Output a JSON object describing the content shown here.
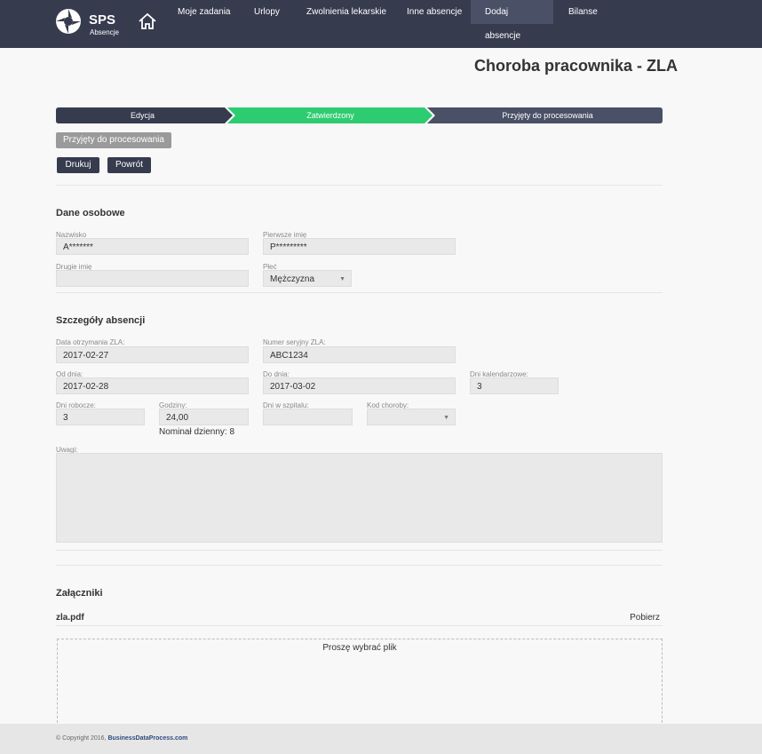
{
  "nav": {
    "brand": "SPS",
    "brand_sub": "Absencje",
    "items": [
      "Moje zadania",
      "Urlopy",
      "Zwolnienia lekarskie",
      "Inne absencje",
      "Dodaj absencje",
      "Bilanse"
    ],
    "active": "Dodaj absencje"
  },
  "page_title": "Choroba pracownika - ZLA",
  "steps": [
    "Edycja",
    "Zatwierdzony",
    "Przyjęty do procesowania"
  ],
  "status_button": "Przyjęty do procesowania",
  "actions": {
    "print": "Drukuj",
    "back": "Powrót"
  },
  "personal": {
    "title": "Dane osobowe",
    "surname_label": "Nazwisko",
    "surname": "A*******",
    "first_name_label": "Pierwsze imię",
    "first_name": "P*********",
    "second_name_label": "Drugie imię",
    "second_name": "",
    "gender_label": "Płeć",
    "gender": "Mężczyzna"
  },
  "absence": {
    "title": "Szczegóły absencji",
    "received_label": "Data otrzymania ZLA:",
    "received": "2017-02-27",
    "serial_label": "Numer seryjny ZLA:",
    "serial": "ABC1234",
    "from_label": "Od dnia:",
    "from": "2017-02-28",
    "to_label": "Do dnia:",
    "to": "2017-03-02",
    "calendar_days_label": "Dni kalendarzowe:",
    "calendar_days": "3",
    "work_days_label": "Dni robocze:",
    "work_days": "3",
    "hours_label": "Godziny:",
    "hours": "24,00",
    "hospital_days_label": "Dni w szpitalu:",
    "hospital_days": "",
    "disease_code_label": "Kod choroby:",
    "disease_code": "",
    "nominal": "Nominał dzienny: 8",
    "notes_label": "Uwagi:"
  },
  "attachments": {
    "title": "Załączniki",
    "file": "zla.pdf",
    "download": "Pobierz",
    "dropzone": "Proszę wybrać plik"
  },
  "footer": {
    "copyright": "© Copyright 2016, ",
    "company": "BusinessDataProcess.com"
  },
  "colors": {
    "nav_bg": "#363b4e",
    "step_done": "#363b4e",
    "step_active": "#2ecc71",
    "step_next": "#4a5066"
  }
}
